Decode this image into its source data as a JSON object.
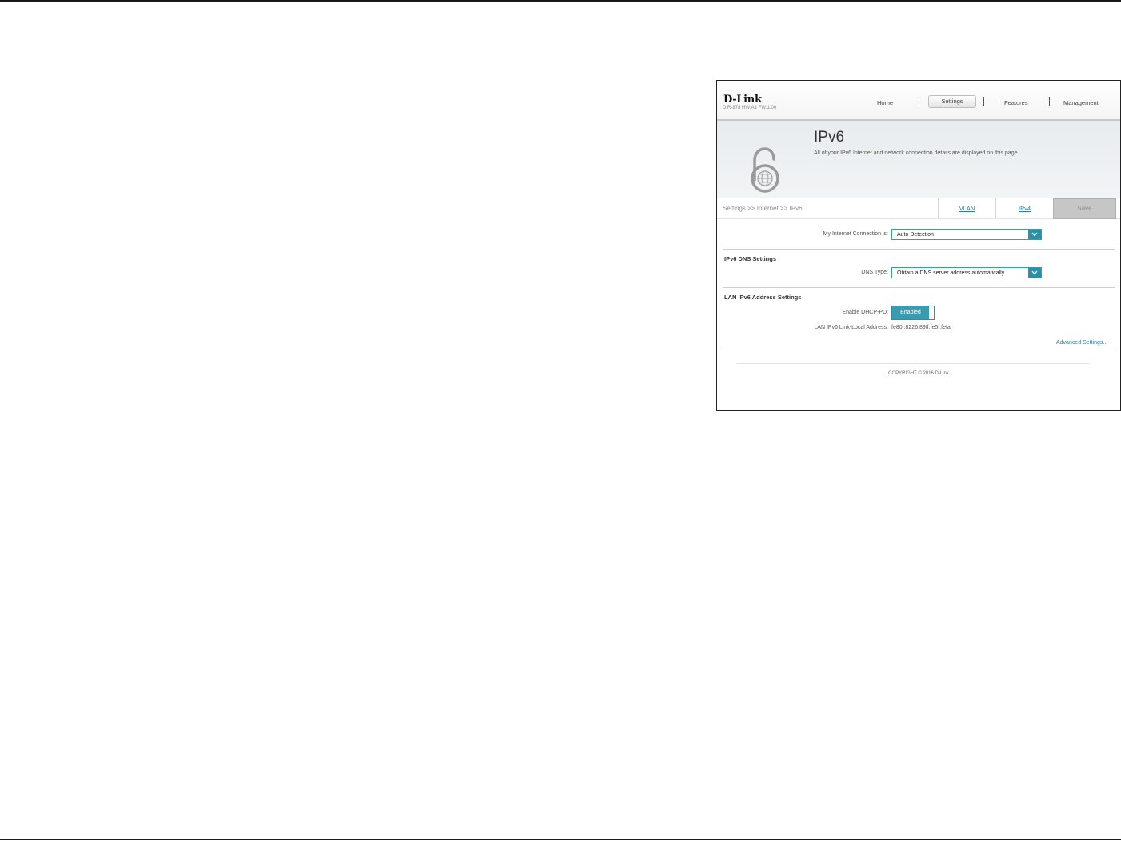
{
  "header": {
    "logo": "D-Link",
    "model": "DIR-878 HW:A1 FW:1.00",
    "nav": [
      "Home",
      "Settings",
      "Features",
      "Management"
    ],
    "active_nav": "Settings"
  },
  "banner": {
    "title": "IPv6",
    "description": "All of your IPv6 Internet and network connection details are displayed on this page.",
    "icon": "ipv6-lock-globe-icon"
  },
  "breadcrumb": "Settings >> Internet >> IPv6",
  "tabs": [
    "VLAN",
    "IPv4"
  ],
  "save_label": "Save",
  "connection": {
    "label": "My Internet Connection is:",
    "value": "Auto Detection"
  },
  "dns": {
    "section_title": "IPv6 DNS Settings",
    "label": "DNS Type:",
    "value": "Obtain a DNS server address automatically"
  },
  "lan": {
    "section_title": "LAN IPv6 Address Settings",
    "dhcp_label": "Enable DHCP-PD:",
    "dhcp_value": "Enabled",
    "link_local_label": "LAN IPv6 Link-Local Address:",
    "link_local_value": "fe80::8226:89ff:fe5f:fefa"
  },
  "advanced_link": "Advanced Settings...",
  "copyright": "COPYRIGHT © 2016 D-Link",
  "colors": {
    "accent": "#3a9bb0",
    "link": "#2a7fb5",
    "save_disabled": "#c6c6c6"
  }
}
